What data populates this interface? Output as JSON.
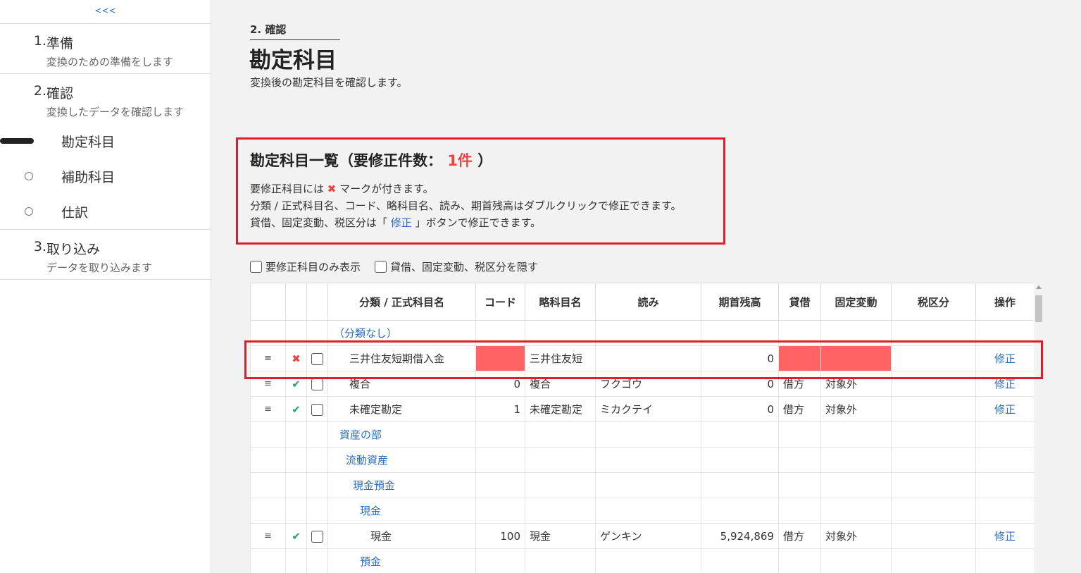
{
  "sidebar": {
    "collapse": "<<<",
    "steps": [
      {
        "num": "1.",
        "title": "準備",
        "desc": "変換のための準備をします"
      },
      {
        "num": "2.",
        "title": "確認",
        "desc": "変換したデータを確認します"
      },
      {
        "num": "3.",
        "title": "取り込み",
        "desc": "データを取り込みます"
      }
    ],
    "subitems": [
      "勘定科目",
      "補助科目",
      "仕訳"
    ]
  },
  "header": {
    "step_label": "2. 確認",
    "title": "勘定科目",
    "desc": "変換後の勘定科目を確認します。"
  },
  "notice": {
    "title_prefix": "勘定科目一覧（要修正件数：",
    "count": "1件",
    "title_suffix": "）",
    "line1_a": "要修正科目には",
    "line1_mark": "✖",
    "line1_b": "マークが付きます。",
    "line2": "分類 / 正式科目名、コード、略科目名、読み、期首残高はダブルクリックで修正できます。",
    "line3_a": "貸借、固定変動、税区分は「",
    "line3_link": "修正",
    "line3_b": "」ボタンで修正できます。"
  },
  "filters": {
    "only_errors": "要修正科目のみ表示",
    "hide_cols": "貸借、固定変動、税区分を隠す"
  },
  "table": {
    "headers": [
      "分類 / 正式科目名",
      "コード",
      "略科目名",
      "読み",
      "期首残高",
      "貸借",
      "固定変動",
      "税区分",
      "操作"
    ],
    "group_none": "（分類なし）",
    "rows": [
      {
        "drag": "≡",
        "status": "✖",
        "name": "三井住友短期借入金",
        "code": "",
        "short": "三井住友短",
        "kana": "",
        "balance": "0",
        "dc": "",
        "fixed": "",
        "tax": "",
        "action": "修正"
      },
      {
        "drag": "≡",
        "status": "✔",
        "name": "複合",
        "code": "0",
        "short": "複合",
        "kana": "フクゴウ",
        "balance": "0",
        "dc": "借方",
        "fixed": "対象外",
        "tax": "",
        "action": "修正"
      },
      {
        "drag": "≡",
        "status": "✔",
        "name": "未確定勘定",
        "code": "1",
        "short": "未確定勘定",
        "kana": "ミカクテイ",
        "balance": "0",
        "dc": "借方",
        "fixed": "対象外",
        "tax": "",
        "action": "修正"
      }
    ],
    "groups": [
      "資産の部",
      "流動資産",
      "現金預金",
      "現金"
    ],
    "cash_row": {
      "drag": "≡",
      "status": "✔",
      "name": "現金",
      "code": "100",
      "short": "現金",
      "kana": "ゲンキン",
      "balance": "5,924,869",
      "dc": "借方",
      "fixed": "対象外",
      "tax": "",
      "action": "修正"
    },
    "last_group": "預金"
  }
}
